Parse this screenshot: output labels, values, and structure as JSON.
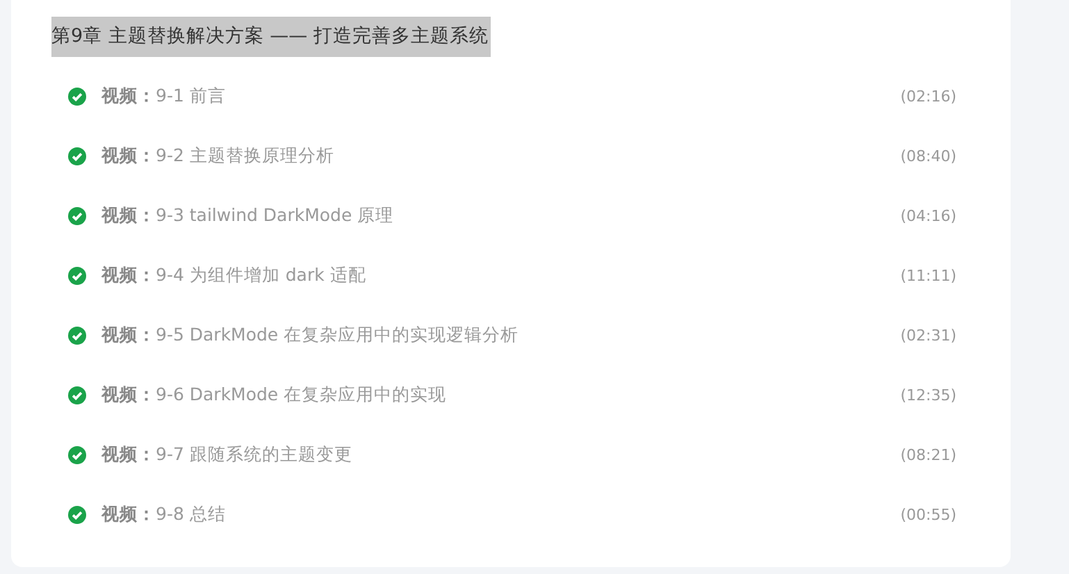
{
  "chapter": {
    "title": "第9章 主题替换解决方案 —— 打造完善多主题系统",
    "highlighted": true
  },
  "lessons": [
    {
      "completed": true,
      "type_label": "视频：",
      "title": "9-1 前言",
      "duration": "(02:16)"
    },
    {
      "completed": true,
      "type_label": "视频：",
      "title": "9-2 主题替换原理分析",
      "duration": "(08:40)"
    },
    {
      "completed": true,
      "type_label": "视频：",
      "title": "9-3 tailwind DarkMode 原理",
      "duration": "(04:16)"
    },
    {
      "completed": true,
      "type_label": "视频：",
      "title": "9-4 为组件增加 dark 适配",
      "duration": "(11:11)"
    },
    {
      "completed": true,
      "type_label": "视频：",
      "title": "9-5 DarkMode 在复杂应用中的实现逻辑分析",
      "duration": "(02:31)"
    },
    {
      "completed": true,
      "type_label": "视频：",
      "title": "9-6 DarkMode 在复杂应用中的实现",
      "duration": "(12:35)"
    },
    {
      "completed": true,
      "type_label": "视频：",
      "title": "9-7 跟随系统的主题变更",
      "duration": "(08:21)"
    },
    {
      "completed": true,
      "type_label": "视频：",
      "title": "9-8 总结",
      "duration": "(00:55)"
    }
  ]
}
